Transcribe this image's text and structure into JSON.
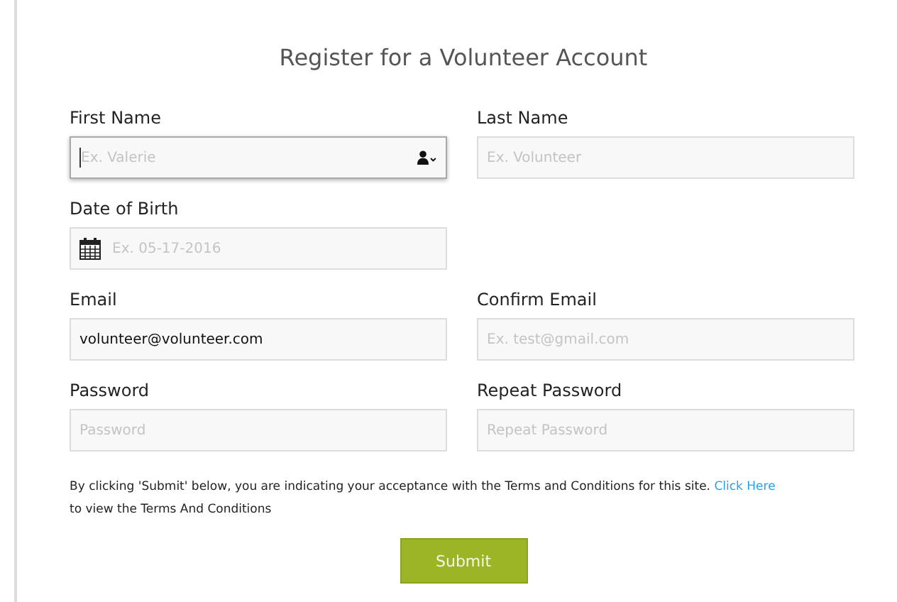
{
  "title": "Register for a Volunteer Account",
  "rows": [
    {
      "fields": [
        {
          "label": "First Name",
          "kind": "text",
          "placeholder": "Ex. Valerie",
          "focused": true,
          "contact_icon": true
        },
        {
          "label": "Last Name",
          "kind": "text",
          "placeholder": "Ex. Volunteer",
          "focused": false,
          "contact_icon": false
        }
      ]
    },
    {
      "fields": [
        {
          "label": "Date of Birth",
          "kind": "date",
          "placeholder": "Ex. 05-17-2016",
          "focused": false,
          "contact_icon": false
        }
      ]
    },
    {
      "fields": [
        {
          "label": "Email",
          "kind": "text",
          "value": "volunteer@volunteer.com",
          "focused": false,
          "contact_icon": false
        },
        {
          "label": "Confirm Email",
          "kind": "text",
          "placeholder": "Ex. test@gmail.com",
          "focused": false,
          "contact_icon": false
        }
      ]
    },
    {
      "fields": [
        {
          "label": "Password",
          "kind": "password",
          "placeholder": "Password",
          "focused": false,
          "contact_icon": false
        },
        {
          "label": "Repeat Password",
          "kind": "password",
          "placeholder": "Repeat Password",
          "focused": false,
          "contact_icon": false
        }
      ]
    }
  ],
  "terms": {
    "text": "By clicking 'Submit' below, you are indicating your acceptance with the Terms and Conditions for this site.",
    "link": "Click Here",
    "text_after": "to view the Terms And Conditions"
  },
  "submit": "Submit"
}
